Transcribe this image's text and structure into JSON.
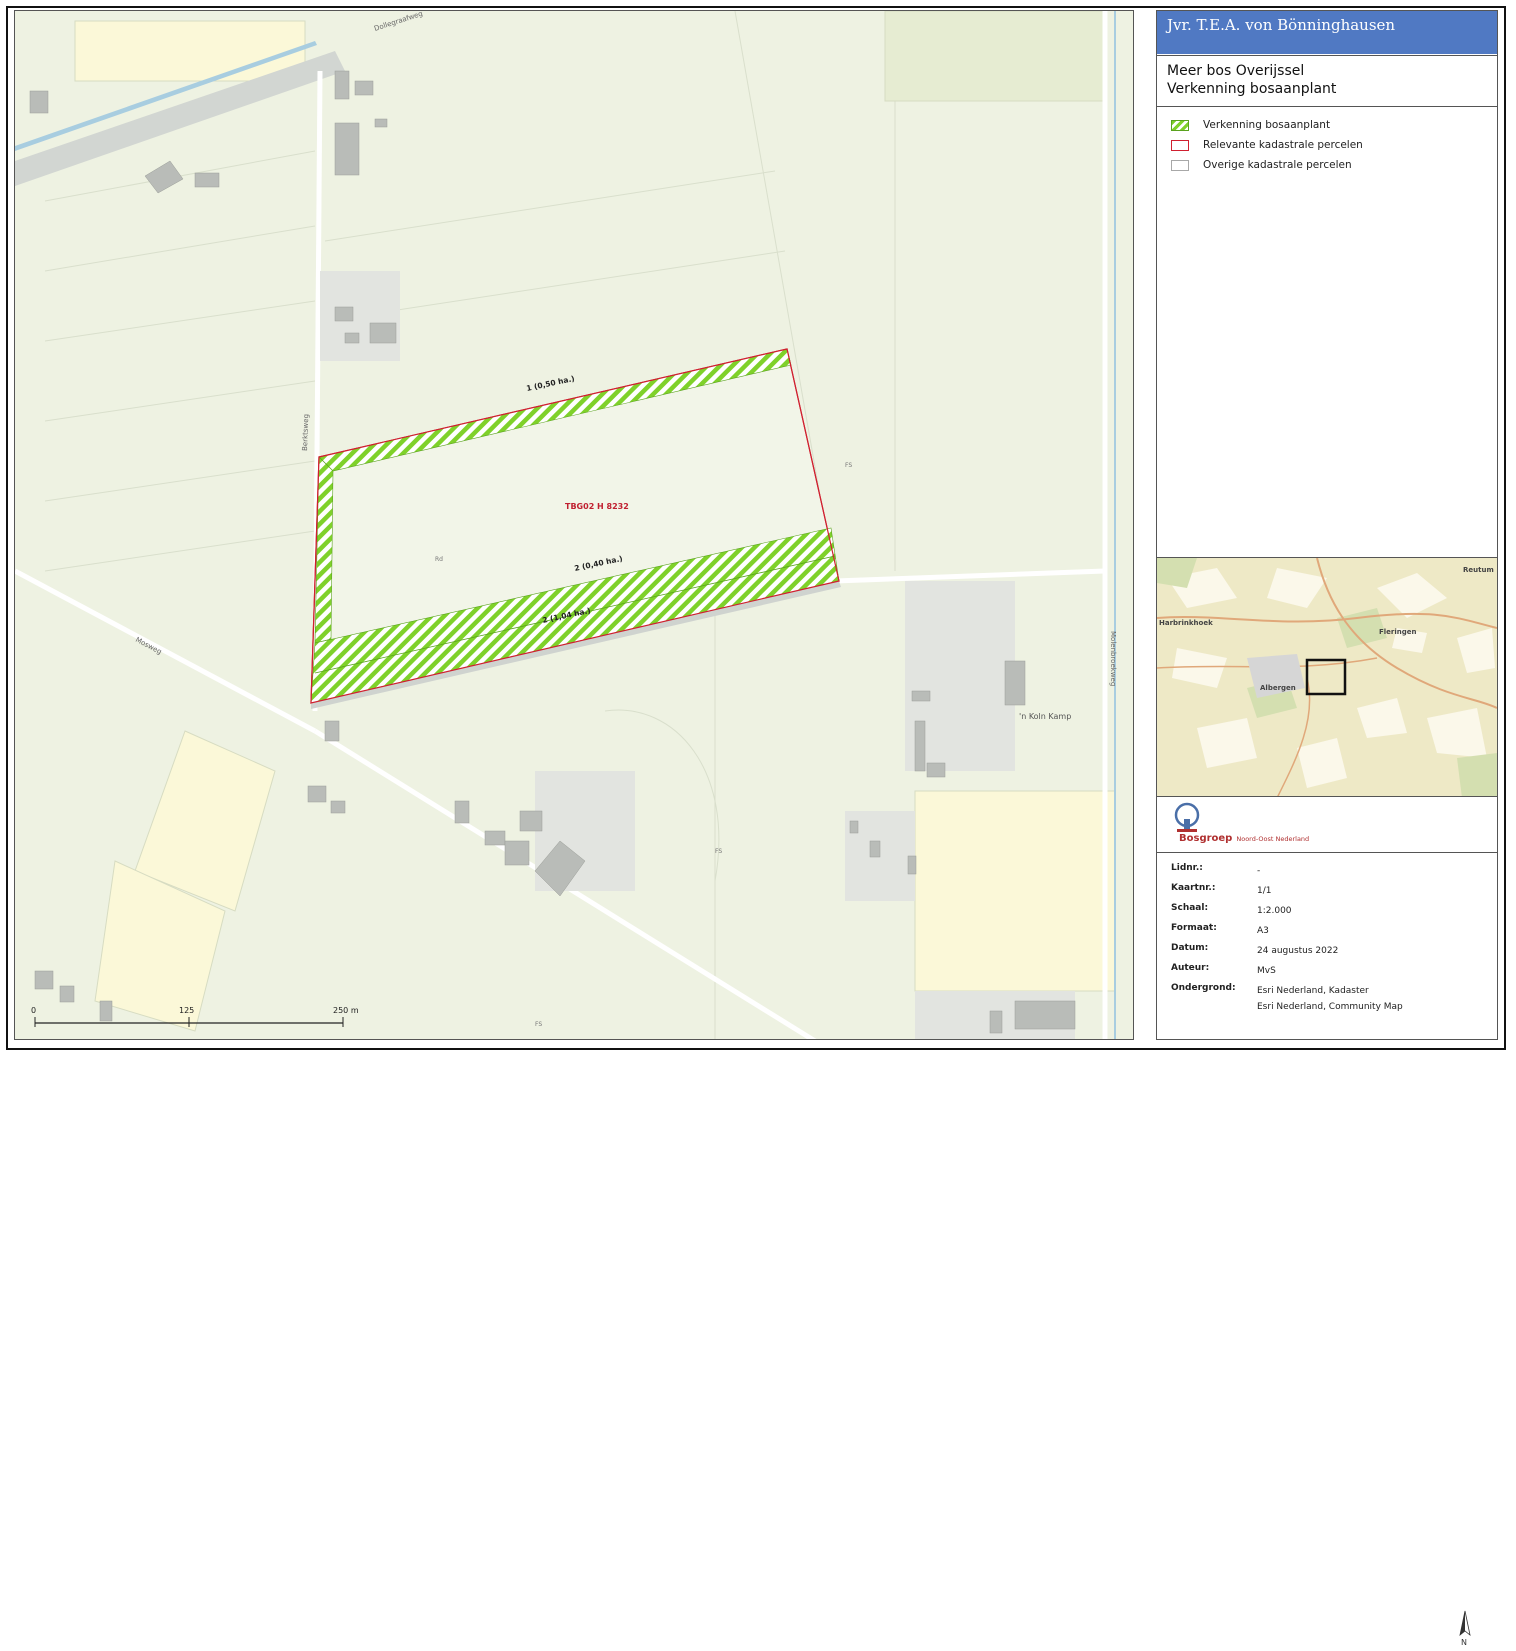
{
  "panel": {
    "client": "Jvr. T.E.A. von Bönninghausen",
    "title1": "Meer bos Overijssel",
    "title2": "Verkenning bosaanplant"
  },
  "legend": [
    {
      "label": "Verkenning bosaanplant",
      "style": "green-hatch",
      "color": "#7fd12a"
    },
    {
      "label": "Relevante kadastrale percelen",
      "style": "red-outline",
      "color": "#d02030"
    },
    {
      "label": "Overige kadastrale percelen",
      "style": "grey-outline",
      "color": "#a8a8a8"
    }
  ],
  "map": {
    "labels": {
      "plot1": "1 (0,50 ha.)",
      "plot2": "2 (0,40 ha.)",
      "plot3": "2 (1,04 ha.)",
      "parcel": "TBG02 H 8232",
      "farm": "'n Koln Kamp",
      "road_west": "Berktsweg",
      "road_diag": "Mosweg",
      "road_east": "Molenbroekweg",
      "canal": "Dollegraafweg",
      "fs1": "FS",
      "fs2": "FS",
      "fs3": "FS",
      "rd1": "Rd"
    },
    "scalebar": {
      "ticks": [
        "0",
        "125",
        "250 m"
      ]
    }
  },
  "overview": {
    "places": [
      "Reutum",
      "Harbrinkhoek",
      "Fleringen",
      "Albergen"
    ]
  },
  "logo": {
    "name": "Bosgroep",
    "subtitle": "Noord-Oost Nederland",
    "north": "N"
  },
  "meta": [
    {
      "key": "Lidnr.:",
      "value": [
        "-"
      ]
    },
    {
      "key": "Kaartnr.:",
      "value": [
        "1/1"
      ]
    },
    {
      "key": "Schaal:",
      "value": [
        "1:2.000"
      ]
    },
    {
      "key": "Formaat:",
      "value": [
        "A3"
      ]
    },
    {
      "key": "Datum:",
      "value": [
        "24 augustus 2022"
      ]
    },
    {
      "key": "Auteur:",
      "value": [
        "MvS"
      ]
    },
    {
      "key": "Ondergrond:",
      "value": [
        "Esri Nederland, Kadaster",
        "Esri Nederland, Community Map"
      ]
    }
  ],
  "colors": {
    "header": "#5079c3",
    "map_bg": "#eef2e2",
    "hatch": "#7fd12a",
    "boundary": "#d02030"
  }
}
